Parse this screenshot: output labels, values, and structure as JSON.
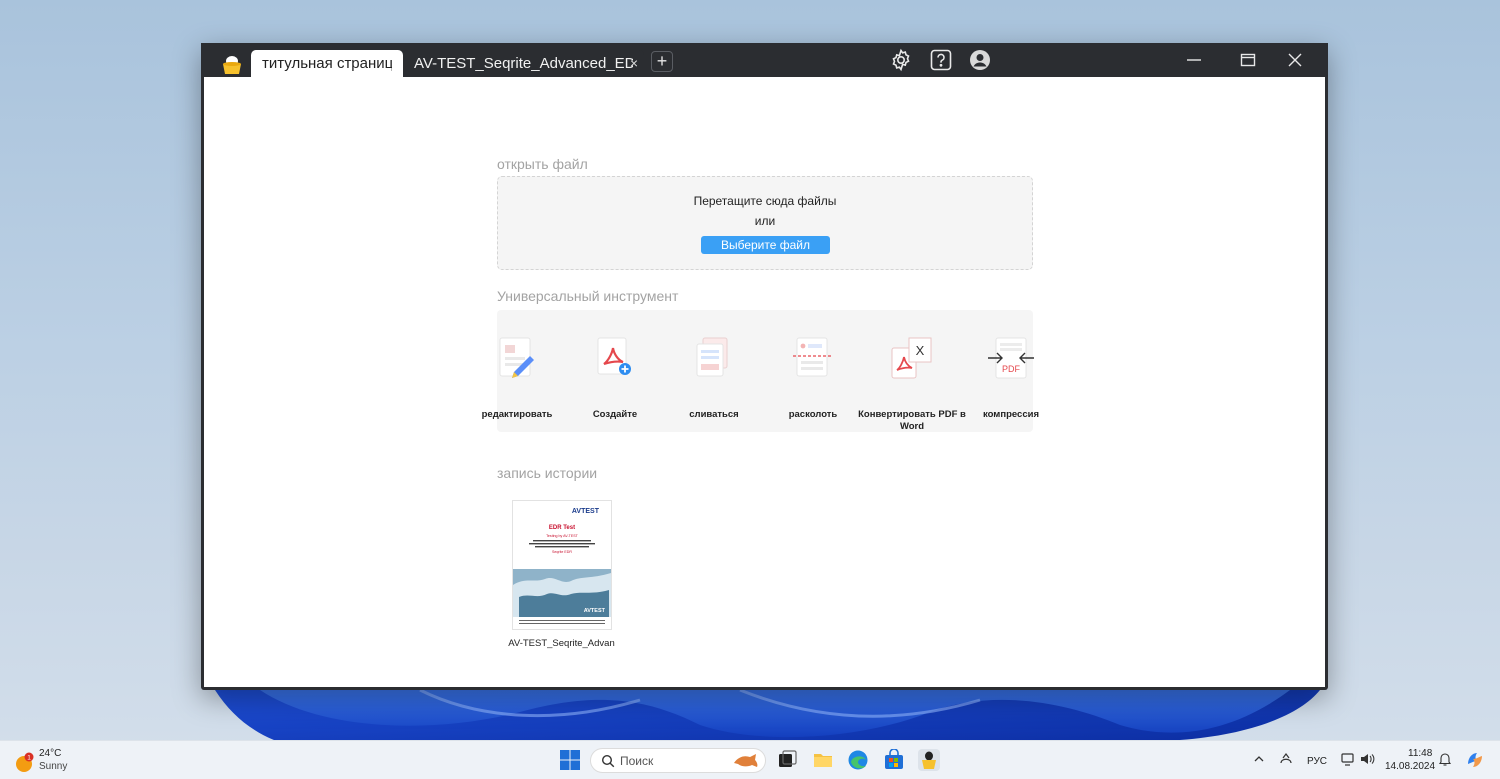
{
  "window": {
    "tabs": [
      {
        "label": "титульная страница",
        "active": true
      },
      {
        "label": "AV-TEST_Seqrite_Advanced_EDR…",
        "active": false
      }
    ],
    "new_tab_label": "+",
    "close_tab_glyph": "×",
    "title_icons": [
      "gear-icon",
      "help-icon",
      "account-icon"
    ],
    "controls": [
      "minimize-icon",
      "maximize-icon",
      "close-icon"
    ]
  },
  "open_file": {
    "heading": "открыть файл",
    "drop_text": "Перетащите сюда файлы",
    "or_text": "или",
    "choose_button": "Выберите файл"
  },
  "tools": {
    "heading": "Универсальный инструмент",
    "items": [
      {
        "label": "редактировать",
        "icon": "edit-pen-icon"
      },
      {
        "label": "Создайте",
        "icon": "create-pdf-icon"
      },
      {
        "label": "сливаться",
        "icon": "merge-icon"
      },
      {
        "label": "расколоть",
        "icon": "split-icon"
      },
      {
        "label": "Конвертировать PDF в Word",
        "icon": "pdf-to-word-icon"
      },
      {
        "label": "компрессия",
        "icon": "compress-pdf-icon"
      }
    ]
  },
  "history": {
    "heading": "запись истории",
    "items": [
      {
        "name": "AV-TEST_Seqrite_Advan",
        "thumb": {
          "brand": "AVTEST",
          "title": "EDR Test",
          "subtitle": "Testing by AV-TEST",
          "product": "Seqrite EDR",
          "footer_brand": "AVTEST"
        }
      }
    ]
  },
  "taskbar": {
    "weather": {
      "temp": "24°C",
      "desc": "Sunny",
      "badge": "1"
    },
    "search_placeholder": "Поиск",
    "language": "РУС",
    "time": "11:48",
    "date": "14.08.2024"
  },
  "colors": {
    "accent": "#3aa0f5",
    "titlebar": "#2b2d31",
    "pdf_red": "#e5484d"
  }
}
